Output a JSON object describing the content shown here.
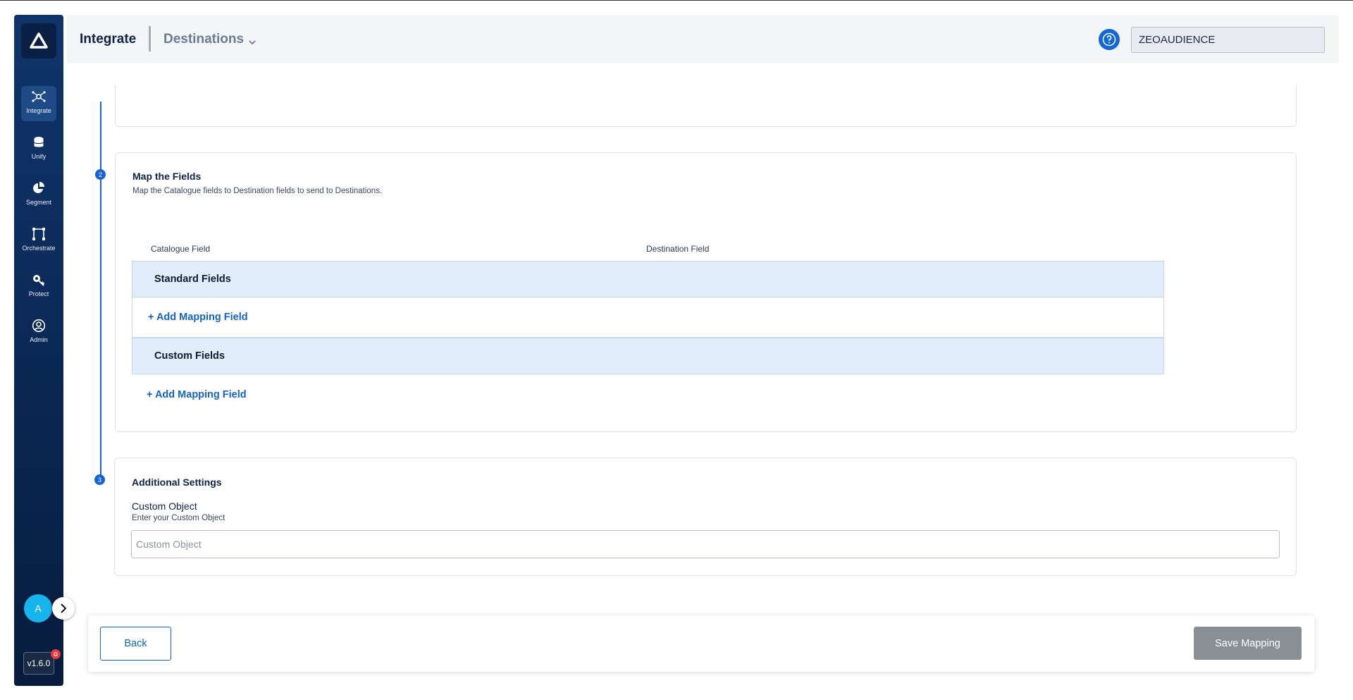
{
  "header": {
    "title": "Integrate",
    "section": "Destinations",
    "org_value": "ZEOAUDIENCE"
  },
  "sidebar": {
    "items": [
      {
        "label": "Integrate",
        "icon": "integrate-icon",
        "active": true
      },
      {
        "label": "Unify",
        "icon": "database-icon",
        "active": false
      },
      {
        "label": "Segment",
        "icon": "pie-chart-icon",
        "active": false
      },
      {
        "label": "Orchestrate",
        "icon": "workflow-icon",
        "active": false
      },
      {
        "label": "Protect",
        "icon": "shield-key-icon",
        "active": false
      },
      {
        "label": "Admin",
        "icon": "user-circle-icon",
        "active": false
      }
    ],
    "avatar": "A",
    "version": "v1.6.0"
  },
  "steps": {
    "step2_number": "2",
    "step3_number": "3"
  },
  "mapping": {
    "title": "Map the Fields",
    "description": "Map the Catalogue fields to Destination fields to send to Destinations.",
    "col_catalogue": "Catalogue Field",
    "col_destination": "Destination Field",
    "standard_group": "Standard Fields",
    "custom_group": "Custom Fields",
    "add_label": "+ Add Mapping Field"
  },
  "additional": {
    "title": "Additional Settings",
    "field_label": "Custom Object",
    "field_hint": "Enter your Custom Object",
    "placeholder": "Custom Object"
  },
  "footer": {
    "back_label": "Back",
    "save_label": "Save Mapping"
  },
  "colors": {
    "primary": "#1463c9",
    "sidebar": "#0b2a58",
    "group_bg": "#e2edfb",
    "disabled_button": "#8a8f96"
  }
}
